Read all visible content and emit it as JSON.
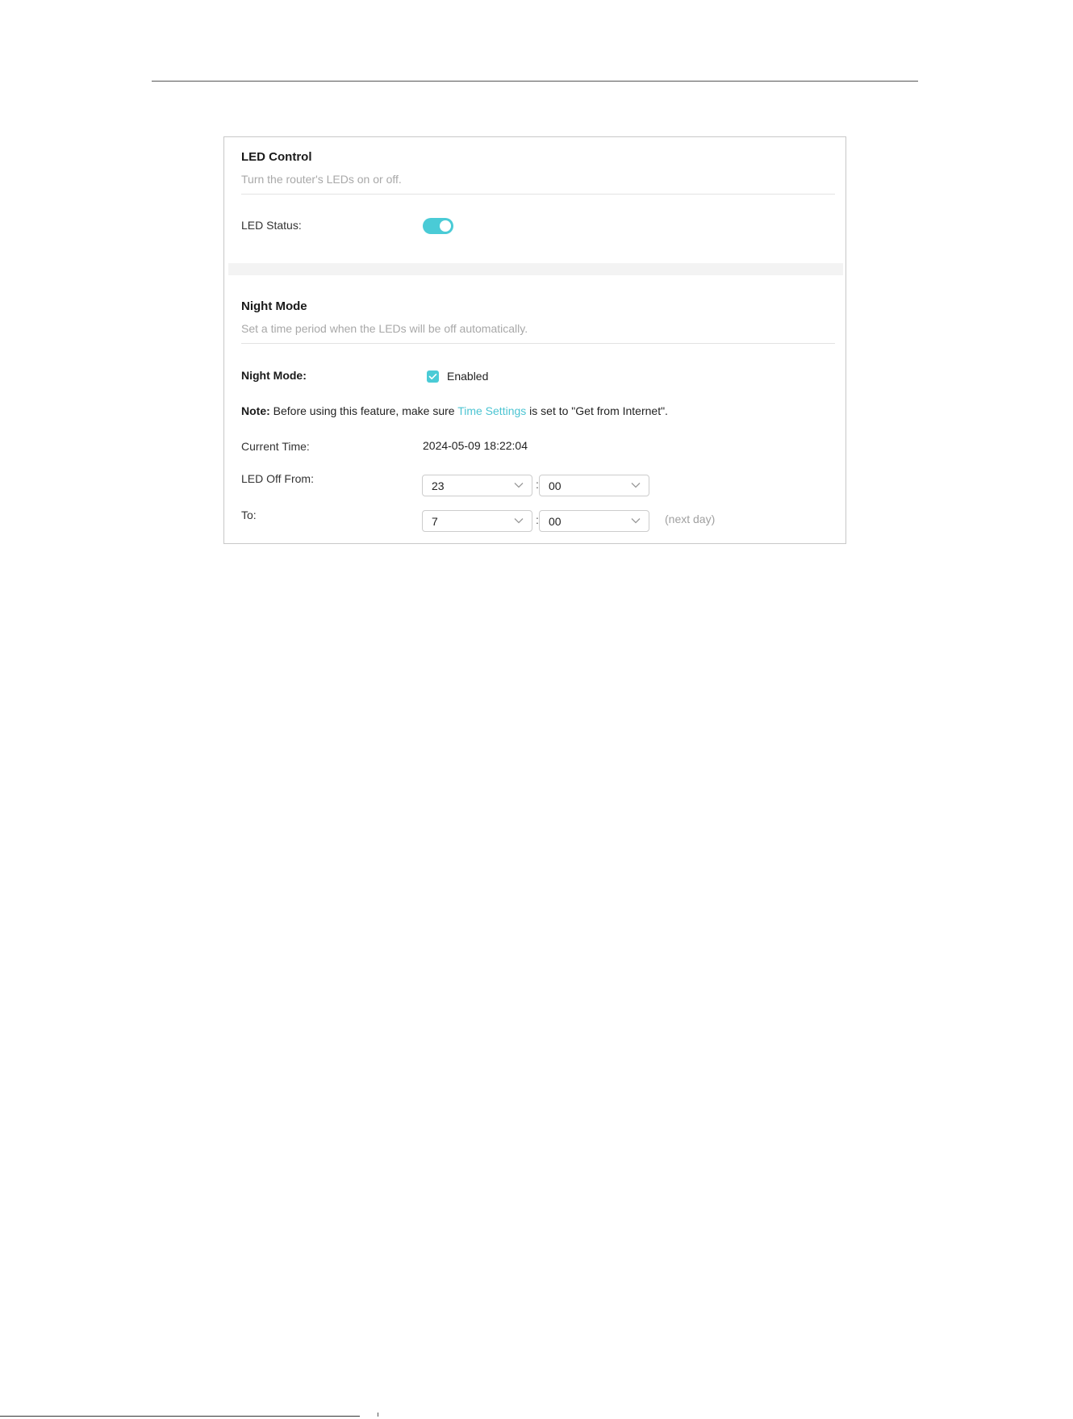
{
  "led_control": {
    "title": "LED Control",
    "description": "Turn the router's LEDs on or off.",
    "status_label": "LED Status:",
    "status_on": true
  },
  "night_mode": {
    "title": "Night Mode",
    "description": "Set a time period when the LEDs will be off automatically.",
    "mode_label": "Night Mode:",
    "enabled_label": "Enabled",
    "enabled": true,
    "note": {
      "prefix": "Note:",
      "before_link": " Before using this feature, make sure ",
      "link": "Time Settings",
      "after_link": " is set to \"Get from Internet\"."
    },
    "current_time_label": "Current Time:",
    "current_time": "2024-05-09 18:22:04",
    "from_label": "LED Off From:",
    "from_hour": "23",
    "from_minute": "00",
    "to_label": "To:",
    "to_hour": "7",
    "to_minute": "00",
    "separator": ":",
    "next_day": "(next day)"
  },
  "colors": {
    "accent": "#4acbd6",
    "link": "#4cc4d2",
    "border": "#c8c8c8",
    "muted_text": "#a8a8a8"
  }
}
